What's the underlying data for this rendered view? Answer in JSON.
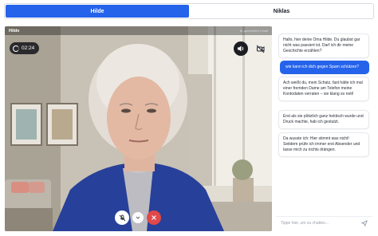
{
  "tabs": [
    {
      "label": "Hilde",
      "active": true
    },
    {
      "label": "Niklas",
      "active": false
    }
  ],
  "video": {
    "caller_name": "Hilde",
    "ai_label": "KI-generierter Inhalt",
    "timer": "02:24"
  },
  "icons": {
    "timer": "progress-ring-icon",
    "speaker": "speaker-icon",
    "camera": "camera-off-icon",
    "mic": "mic-off-icon",
    "dropdown": "chevron-down-icon",
    "end_call": "close-icon",
    "send": "send-icon"
  },
  "chat": {
    "messages": [
      {
        "role": "assistant",
        "text": "Hallo, hier deine Oma Hilde. Du glaubst gar nicht was passiert ist. Darf ich dir meine Geschichte erzählen?"
      },
      {
        "role": "user",
        "text": "wie kann ich dich gegen Spam schützen?"
      },
      {
        "role": "assistant",
        "text": "Ach weißt du, mein Schatz, fast hätte ich mal einer fremden Dame am Telefon meine Kontodaten verraten – sie klang so nett!"
      },
      {
        "role": "assistant",
        "text": "Erst als sie plötzlich ganz hektisch wurde und Druck machte, hab ich gestutzt."
      },
      {
        "role": "assistant",
        "text": "Da wusste ich: Hier stimmt was nicht! Seitdem prüfe ich immer erst Absender und lasse mich zu nichts drängen."
      }
    ],
    "input_placeholder": "Tippe hier, um zu chatten..."
  },
  "colors": {
    "accent": "#2563eb",
    "end_call": "#e0484a"
  }
}
